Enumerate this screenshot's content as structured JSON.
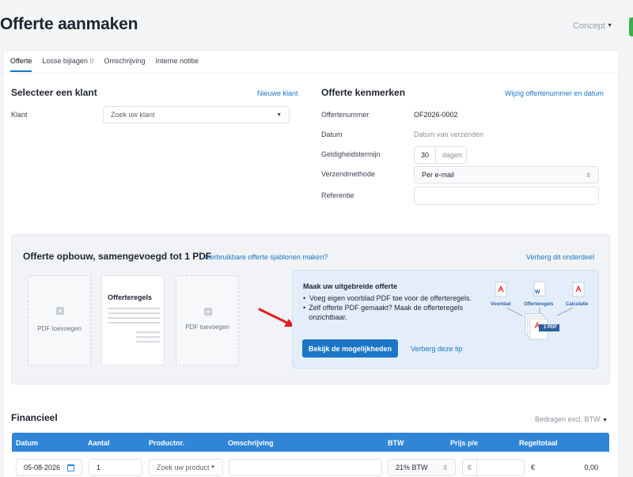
{
  "header": {
    "title": "Offerte aanmaken",
    "status": "Concept"
  },
  "tabs": [
    {
      "label": "Offerte"
    },
    {
      "label": "Losse bijlagen",
      "count": "0"
    },
    {
      "label": "Omschrijving"
    },
    {
      "label": "Interne notitie"
    }
  ],
  "client": {
    "heading": "Selecteer een klant",
    "new_link": "Nieuwe klant",
    "label": "Klant",
    "placeholder": "Zoek uw klant"
  },
  "quote": {
    "heading": "Offerte kenmerken",
    "edit_link": "Wijzig offertenummer en datum",
    "number_label": "Offertenummer",
    "number_value": "OF2026-0002",
    "date_label": "Datum",
    "date_value": "Datum van verzenden",
    "validity_label": "Geldigheidstermijn",
    "validity_value": "30",
    "validity_unit": "dagen",
    "send_label": "Verzendmethode",
    "send_value": "Per e-mail",
    "ref_label": "Referentie",
    "ref_value": ""
  },
  "build": {
    "heading": "Offerte opbouw, samengevoegd tot 1 PDF",
    "templates_link": "Herbruikbare offerte sjablonen maken?",
    "hide_section": "Verberg dit onderdeel",
    "add_pdf_left": "PDF toevoegen",
    "lines_card": "Offerteregels",
    "add_pdf_right": "PDF toevoegen"
  },
  "tip": {
    "title": "Maak uw uitgebreide offerte",
    "bullets": [
      "Voeg eigen voorblad PDF toe voor de offerteregels.",
      "Zelf offerte PDF gemaakt? Maak de offerteregels onzichtbaar."
    ],
    "button": "Bekijk de mogelijkheden",
    "hide_tip": "Verberg deze tip",
    "diagram": {
      "cover": "Voorblad",
      "lines": "Offerteregels",
      "calc": "Calculatie",
      "merged": "1 PDF"
    }
  },
  "financial": {
    "heading": "Financieel",
    "amounts": "Bedragen excl. BTW",
    "columns": [
      "Datum",
      "Aantal",
      "Productnr.",
      "Omschrijving",
      "BTW",
      "Prijs p/e",
      "Regeltotaal"
    ],
    "row": {
      "date": "05-08-2026",
      "qty": "1",
      "product_placeholder": "Zoek uw product",
      "description": "",
      "vat": "21% BTW",
      "price_currency": "€",
      "total_currency": "€",
      "total": "0,00"
    }
  },
  "colors": {
    "accent": "#1b76c6",
    "table_header": "#2f86d6",
    "arrow": "#e11d25",
    "pdf_red": "#e5322d"
  }
}
